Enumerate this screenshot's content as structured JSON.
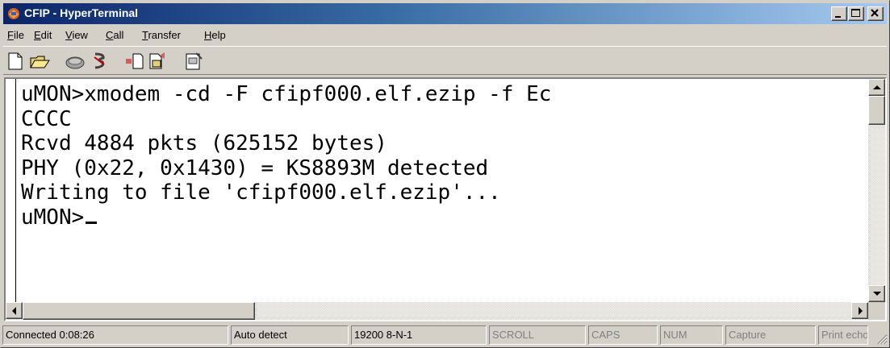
{
  "window": {
    "title": "CFIP - HyperTerminal"
  },
  "menu": [
    {
      "label": "File",
      "key": "F",
      "rest": "ile"
    },
    {
      "label": "Edit",
      "key": "E",
      "rest": "dit"
    },
    {
      "label": "View",
      "key": "V",
      "rest": "iew"
    },
    {
      "label": "Call",
      "key": "C",
      "rest": "all"
    },
    {
      "label": "Transfer",
      "key": "T",
      "rest": "ransfer"
    },
    {
      "label": "Help",
      "key": "H",
      "rest": "elp"
    }
  ],
  "toolbar": {
    "new_icon": "new-document-icon",
    "open_icon": "open-folder-icon",
    "call_icon": "phone-call-icon",
    "disconnect_icon": "disconnect-icon",
    "send_icon": "send-file-icon",
    "receive_icon": "receive-file-icon",
    "properties_icon": "properties-icon"
  },
  "terminal": {
    "lines": [
      "uMON>xmodem -cd -F cfipf000.elf.ezip -f Ec",
      "CCCC",
      "Rcvd 4884 pkts (625152 bytes)",
      "PHY (0x22, 0x1430) = KS8893M detected",
      "Writing to file 'cfipf000.elf.ezip'...",
      "uMON>"
    ]
  },
  "status": {
    "connected": "Connected 0:08:26",
    "detect": "Auto detect",
    "settings": "19200 8-N-1",
    "scroll": "SCROLL",
    "caps": "CAPS",
    "num": "NUM",
    "capture": "Capture",
    "print": "Print echo"
  },
  "colors": {
    "title_start": "#0a246a",
    "title_end": "#a6caf0",
    "face": "#d4d0c8"
  }
}
